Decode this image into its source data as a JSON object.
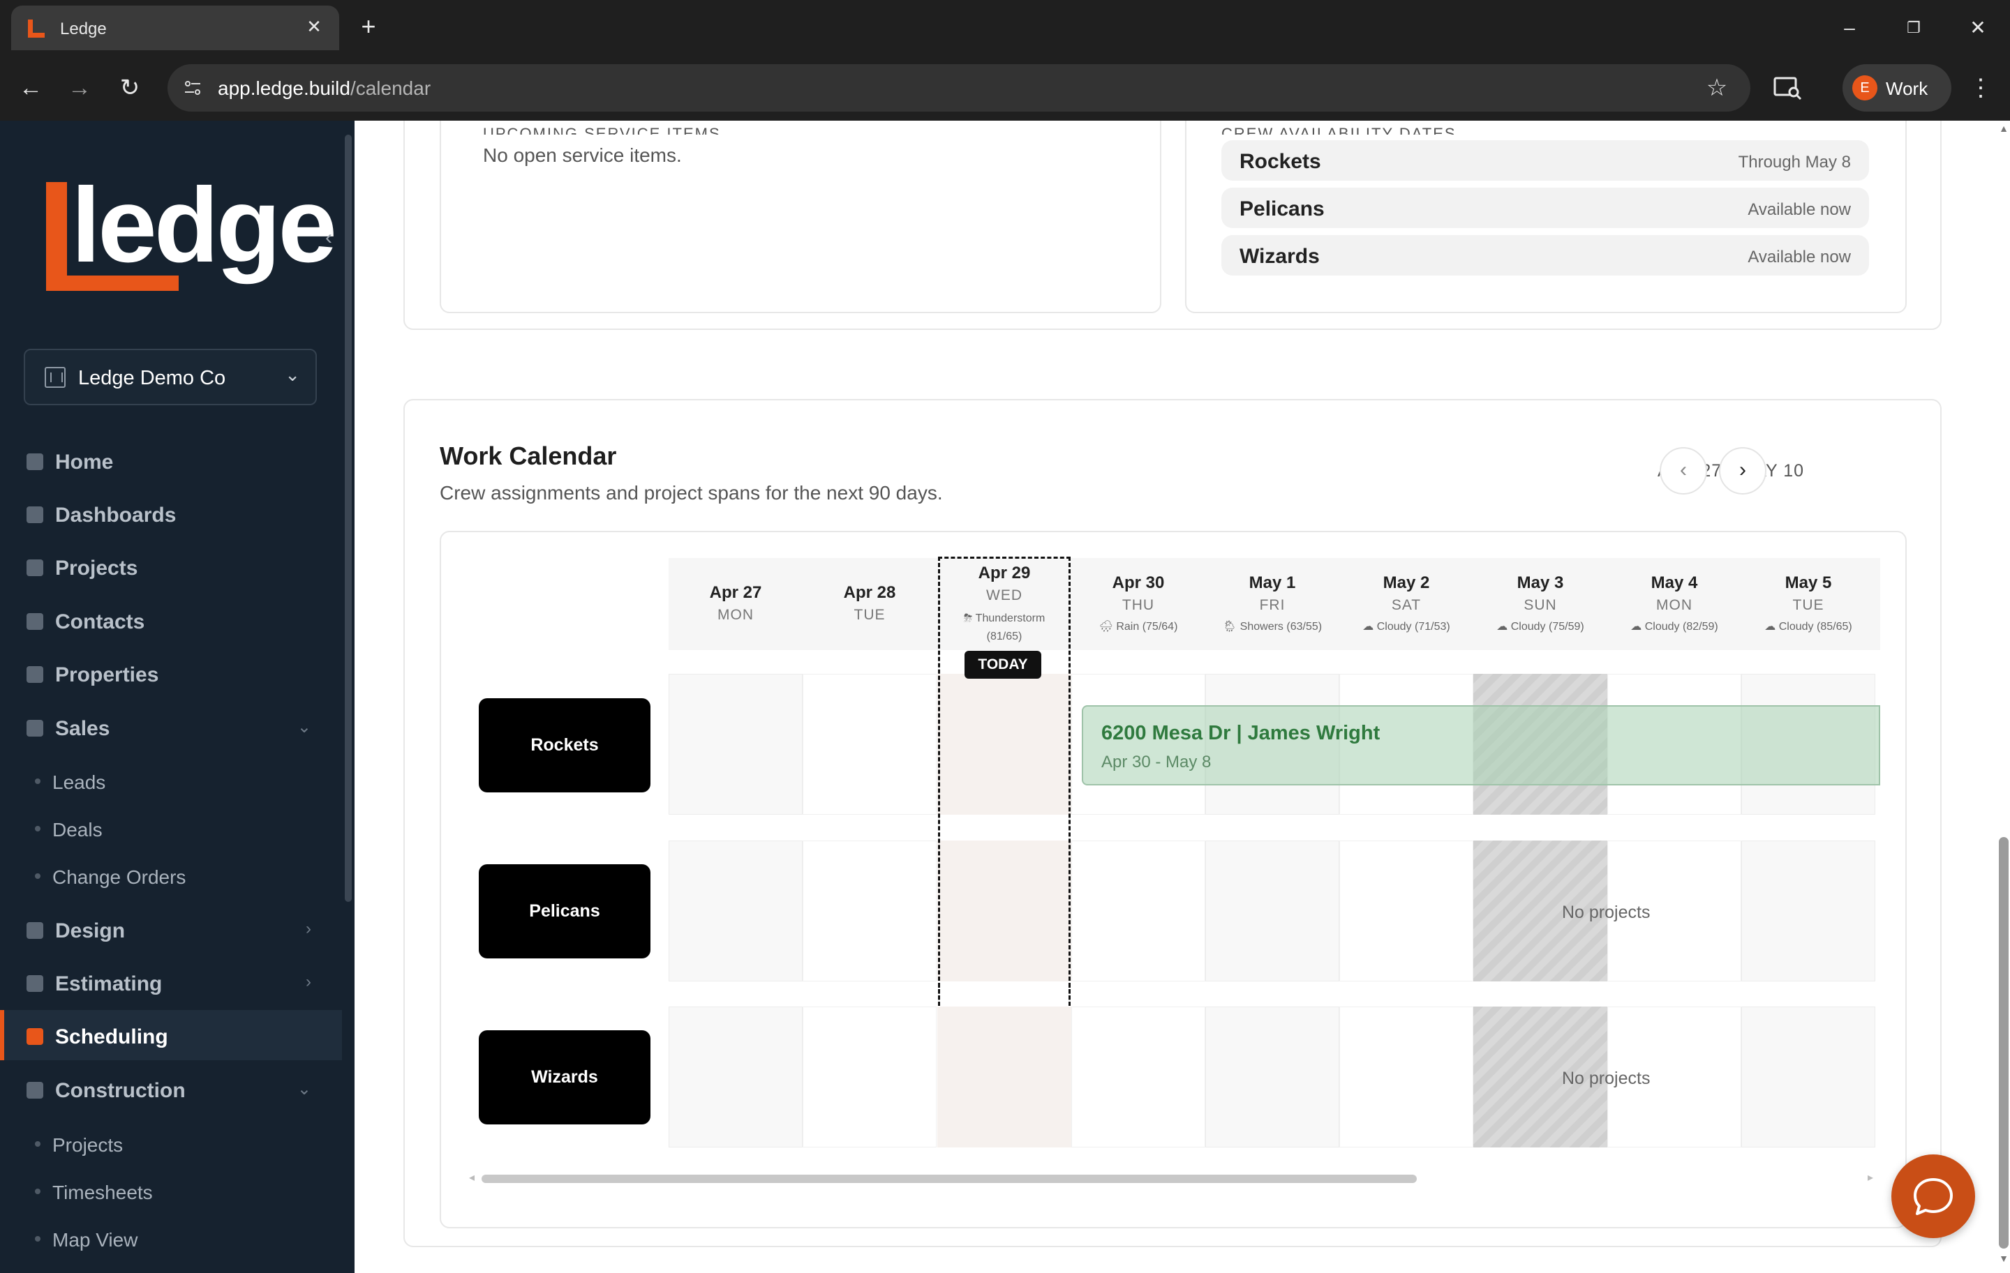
{
  "browser": {
    "tab_title": "Ledge",
    "url_host": "app.ledge.build",
    "url_path": "/calendar",
    "profile_initial": "E",
    "profile_label": "Work"
  },
  "sidebar": {
    "logo_text": "ledge",
    "company": "Ledge Demo Co",
    "nav": [
      {
        "label": "Home"
      },
      {
        "label": "Dashboards"
      },
      {
        "label": "Projects"
      },
      {
        "label": "Contacts"
      },
      {
        "label": "Properties"
      },
      {
        "label": "Sales"
      },
      {
        "label": "Leads"
      },
      {
        "label": "Deals"
      },
      {
        "label": "Change Orders"
      },
      {
        "label": "Design"
      },
      {
        "label": "Estimating"
      },
      {
        "label": "Scheduling"
      },
      {
        "label": "Construction"
      },
      {
        "label": "Projects"
      },
      {
        "label": "Timesheets"
      },
      {
        "label": "Map View"
      }
    ],
    "active": "Scheduling"
  },
  "service": {
    "heading_cut": "UPCOMING SERVICE ITEMS",
    "empty": "No open service items."
  },
  "availability": {
    "heading_cut": "CREW AVAILABILITY DATES",
    "rows": [
      {
        "crew": "Rockets",
        "date": "Through May 8"
      },
      {
        "crew": "Pelicans",
        "date": "Available now"
      },
      {
        "crew": "Wizards",
        "date": "Available now"
      }
    ]
  },
  "calendar": {
    "title": "Work Calendar",
    "subtitle": "Crew assignments and project spans for the next 90 days.",
    "range": "APR 27 - MAY 10",
    "today_label": "TODAY",
    "days": [
      {
        "date": "Apr 27",
        "weekday": "MON",
        "weather": ""
      },
      {
        "date": "Apr 28",
        "weekday": "TUE",
        "weather": ""
      },
      {
        "date": "Apr 29",
        "weekday": "WED",
        "weather": "⛈ Thunderstorm (81/65)"
      },
      {
        "date": "Apr 30",
        "weekday": "THU",
        "weather": "🌧 Rain (75/64)"
      },
      {
        "date": "May 1",
        "weekday": "FRI",
        "weather": "🌦 Showers (63/55)"
      },
      {
        "date": "May 2",
        "weekday": "SAT",
        "weather": "☁ Cloudy (71/53)"
      },
      {
        "date": "May 3",
        "weekday": "SUN",
        "weather": "☁ Cloudy (75/59)"
      },
      {
        "date": "May 4",
        "weekday": "MON",
        "weather": "☁ Cloudy (82/59)"
      },
      {
        "date": "May 5",
        "weekday": "TUE",
        "weather": "☁ Cloudy (85/65)"
      }
    ],
    "crews": [
      "Rockets",
      "Pelicans",
      "Wizards"
    ],
    "project": {
      "title": "6200 Mesa Dr | James Wright",
      "dates": "Apr 30 - May 8"
    },
    "no_projects": "No projects"
  },
  "colors": {
    "accent": "#e8561a",
    "sidebar_bg": "#16222f",
    "project_green": "#2f7a3e"
  }
}
